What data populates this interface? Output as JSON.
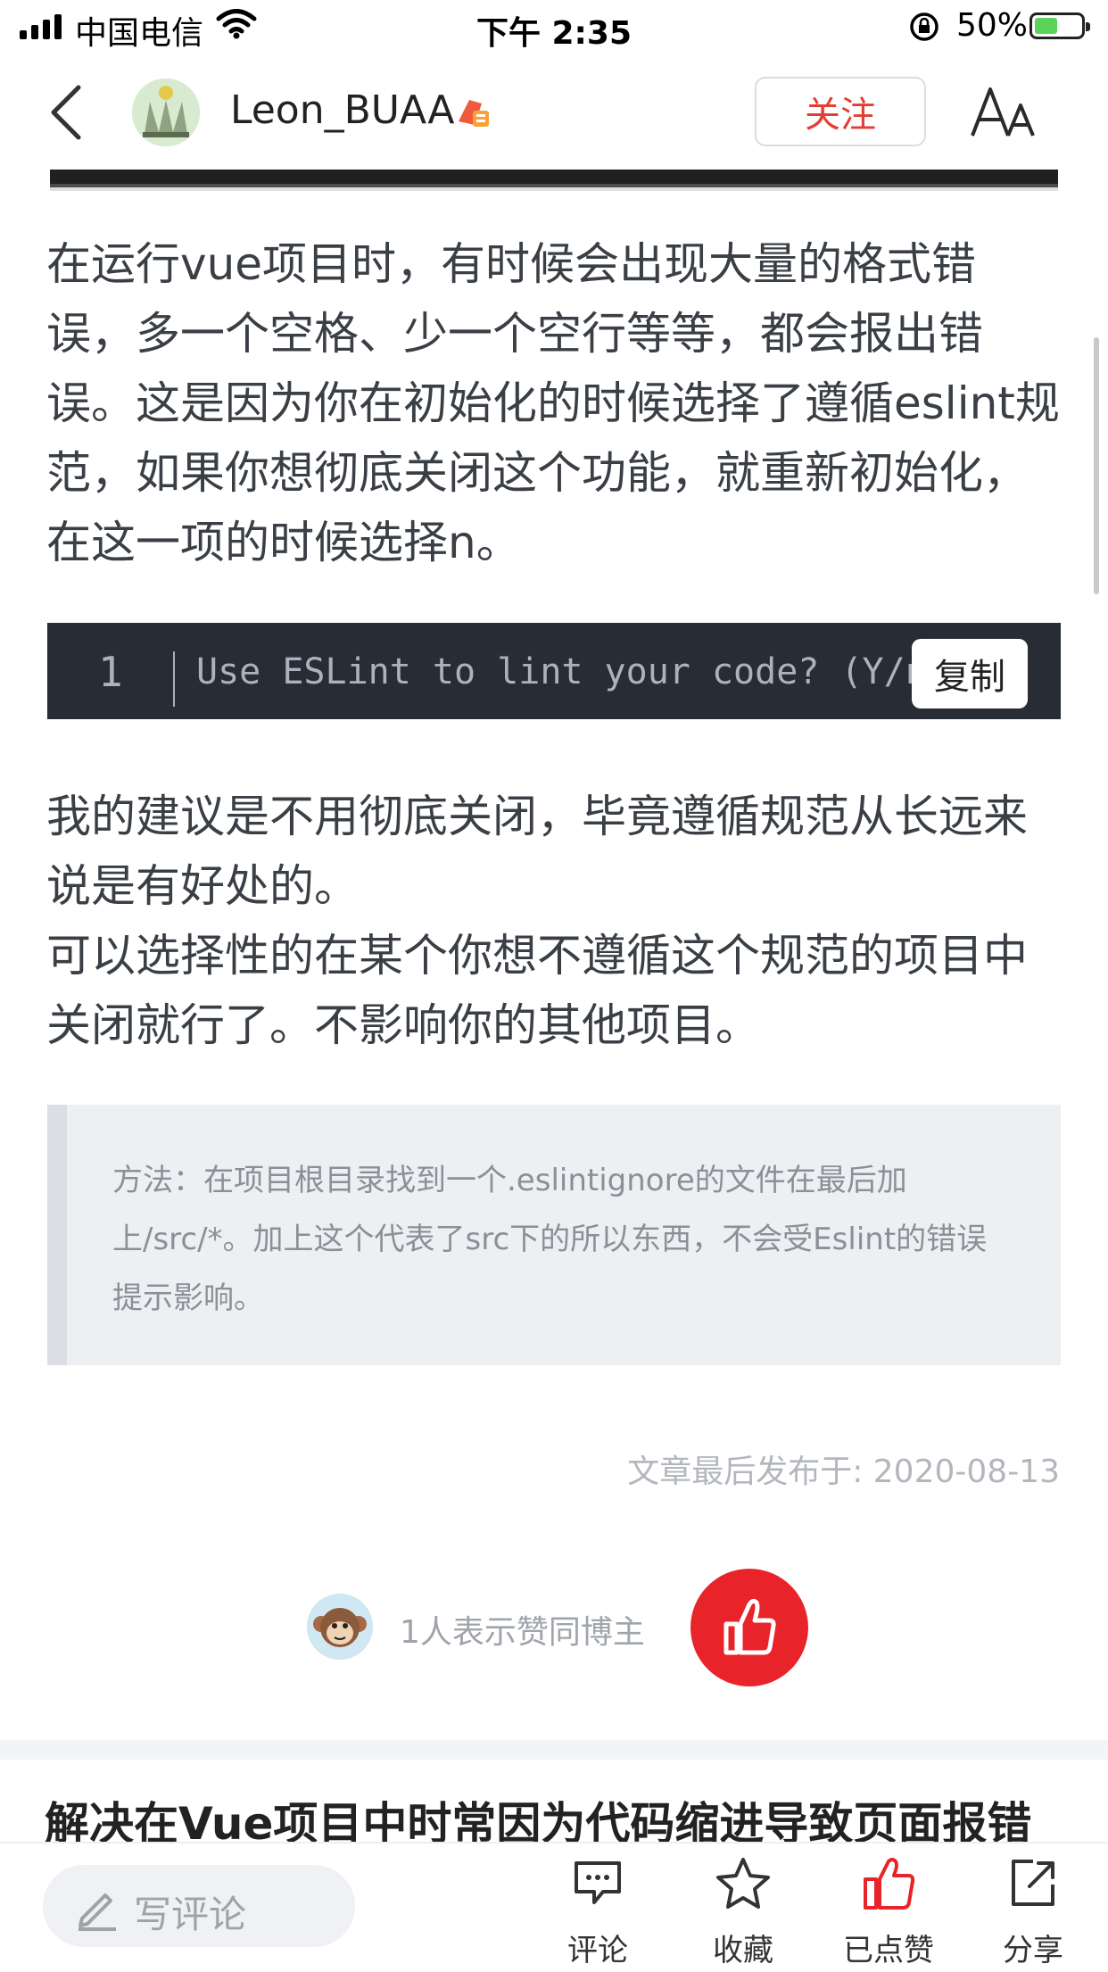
{
  "status_bar": {
    "carrier": "中国电信",
    "time": "下午 2:35",
    "battery_percent": "50%",
    "battery_level": 0.5
  },
  "header": {
    "author_name": "Leon_BUAA",
    "follow_label": "关注"
  },
  "article": {
    "paragraph_1": "在运行vue项目时，有时候会出现大量的格式错误，多一个空格、少一个空行等等，都会报出错误。这是因为你在初始化的时候选择了遵循eslint规范，如果你想彻底关闭这个功能，就重新初始化，在这一项的时候选择n。",
    "code_block": {
      "line_number": "1",
      "code": "Use ESLint to lint your code? (Y/n)",
      "copy_label": "复制"
    },
    "paragraph_2": "我的建议是不用彻底关闭，毕竟遵循规范从长远来说是有好处的。",
    "paragraph_3": "可以选择性的在某个你想不遵循这个规范的项目中关闭就行了。不影响你的其他项目。",
    "blockquote": "方法：在项目根目录找到一个.eslintignore的文件在最后加上/src/*。加上这个代表了src下的所以东西，不会受Eslint的错误提示影响。",
    "published": "文章最后发布于: 2020-08-13"
  },
  "likes": {
    "text": "1人表示赞同博主"
  },
  "next_article": {
    "title": "解决在Vue项目中时常因为代码缩进导致页面报错"
  },
  "bottom_bar": {
    "comment_placeholder": "写评论",
    "comment_label": "评论",
    "favorite_label": "收藏",
    "liked_label": "已点赞",
    "share_label": "分享"
  },
  "colors": {
    "accent_red": "#e8242a",
    "follow_text": "#e33e33",
    "code_bg": "#282c34"
  }
}
